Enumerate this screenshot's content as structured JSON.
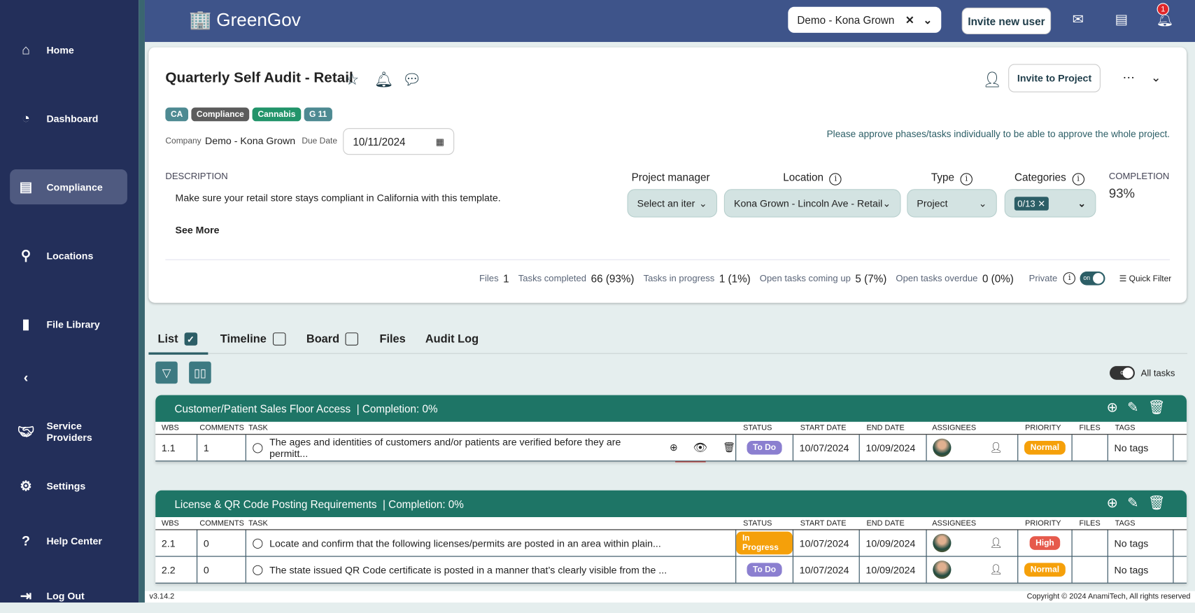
{
  "app": {
    "name": "GreenGov",
    "version": "v3.14.2",
    "copyright": "Copyright © 2024 AnamiTech, All rights reserved"
  },
  "sidebar": {
    "items": [
      {
        "label": "Home",
        "icon": "home-icon"
      },
      {
        "label": "Dashboard",
        "icon": "pie-chart-icon"
      },
      {
        "label": "Compliance",
        "icon": "inbox-icon",
        "active": true
      },
      {
        "label": "Locations",
        "icon": "map-pin-icon"
      },
      {
        "label": "File Library",
        "icon": "file-icon"
      },
      {
        "label": "",
        "icon": "chevron-left-icon"
      },
      {
        "label": "Service Providers",
        "icon": "handshake-icon"
      },
      {
        "label": "Settings",
        "icon": "gear-icon"
      },
      {
        "label": "Help Center",
        "icon": "help-icon"
      },
      {
        "label": "Log Out",
        "icon": "logout-icon"
      }
    ]
  },
  "header": {
    "company_select": "Demo - Kona Grown",
    "invite_user": "Invite new user",
    "notification_count": "1"
  },
  "project": {
    "title": "Quarterly Self Audit - Retail",
    "tags": [
      {
        "label": "CA",
        "color": "#4e8a92"
      },
      {
        "label": "Compliance",
        "color": "#5c5c5c"
      },
      {
        "label": "Cannabis",
        "color": "#22946a"
      },
      {
        "label": "G 11",
        "color": "#4e8a92"
      }
    ],
    "company_label": "Company",
    "company": "Demo - Kona Grown",
    "due_date_label": "Due Date",
    "due_date": "10/11/2024",
    "approve_note": "Please approve phases/tasks individually to be able to approve the whole project.",
    "invite_to_project": "Invite to Project",
    "description_label": "DESCRIPTION",
    "description": "Make sure your retail store stays compliant in California with this template.",
    "see_more": "See More",
    "fields": {
      "pm_label": "Project manager",
      "pm_value": "Select an iter",
      "location_label": "Location",
      "location_value": "Kona Grown - Lincoln Ave - Retail",
      "type_label": "Type",
      "type_value": "Project",
      "categories_label": "Categories",
      "categories_value": "0/13"
    },
    "completion_label": "COMPLETION",
    "completion": "93%",
    "stats": {
      "files_label": "Files",
      "files": "1",
      "completed_label": "Tasks completed",
      "completed": "66 (93%)",
      "progress_label": "Tasks in progress",
      "progress": "1 (1%)",
      "upcoming_label": "Open tasks coming up",
      "upcoming": "5 (7%)",
      "overdue_label": "Open tasks overdue",
      "overdue": "0 (0%)",
      "private_label": "Private",
      "private_toggle": "on",
      "quick_filter": "Quick Filter"
    }
  },
  "tabs": [
    {
      "label": "List",
      "checked": true
    },
    {
      "label": "Timeline",
      "checked": false
    },
    {
      "label": "Board",
      "checked": false
    },
    {
      "label": "Files"
    },
    {
      "label": "Audit Log"
    }
  ],
  "all_tasks": {
    "label": "All tasks",
    "toggle": "off"
  },
  "columns": [
    "WBS",
    "COMMENTS",
    "TASK",
    "STATUS",
    "START DATE",
    "END DATE",
    "ASSIGNEES",
    "PRIORITY",
    "FILES",
    "TAGS"
  ],
  "sections": [
    {
      "title": "Customer/Patient Sales Floor Access",
      "completion": "| Completion: 0%",
      "rows": [
        {
          "wbs": "1.1",
          "comments": "1",
          "task": "The ages and identities of customers and/or patients are verified before they are permitt...",
          "status": "To Do",
          "status_color": "#8b7fd0",
          "start": "10/07/2024",
          "end": "10/09/2024",
          "priority": "Normal",
          "priority_color": "#f5a00a",
          "tags": "No tags"
        }
      ]
    },
    {
      "title": "License & QR Code Posting Requirements",
      "completion": "| Completion: 0%",
      "rows": [
        {
          "wbs": "2.1",
          "comments": "0",
          "task": "Locate and confirm that the following licenses/permits are posted in an area within plain...",
          "status": "In Progress",
          "status_color": "#f5a00a",
          "start": "10/07/2024",
          "end": "10/09/2024",
          "priority": "High",
          "priority_color": "#e65a4c",
          "tags": "No tags"
        },
        {
          "wbs": "2.2",
          "comments": "0",
          "task": "The state issued QR Code certificate is posted in a manner that’s clearly visible from the ...",
          "status": "To Do",
          "status_color": "#8b7fd0",
          "start": "10/07/2024",
          "end": "10/09/2024",
          "priority": "Normal",
          "priority_color": "#f5a00a",
          "tags": "No tags"
        }
      ]
    }
  ]
}
